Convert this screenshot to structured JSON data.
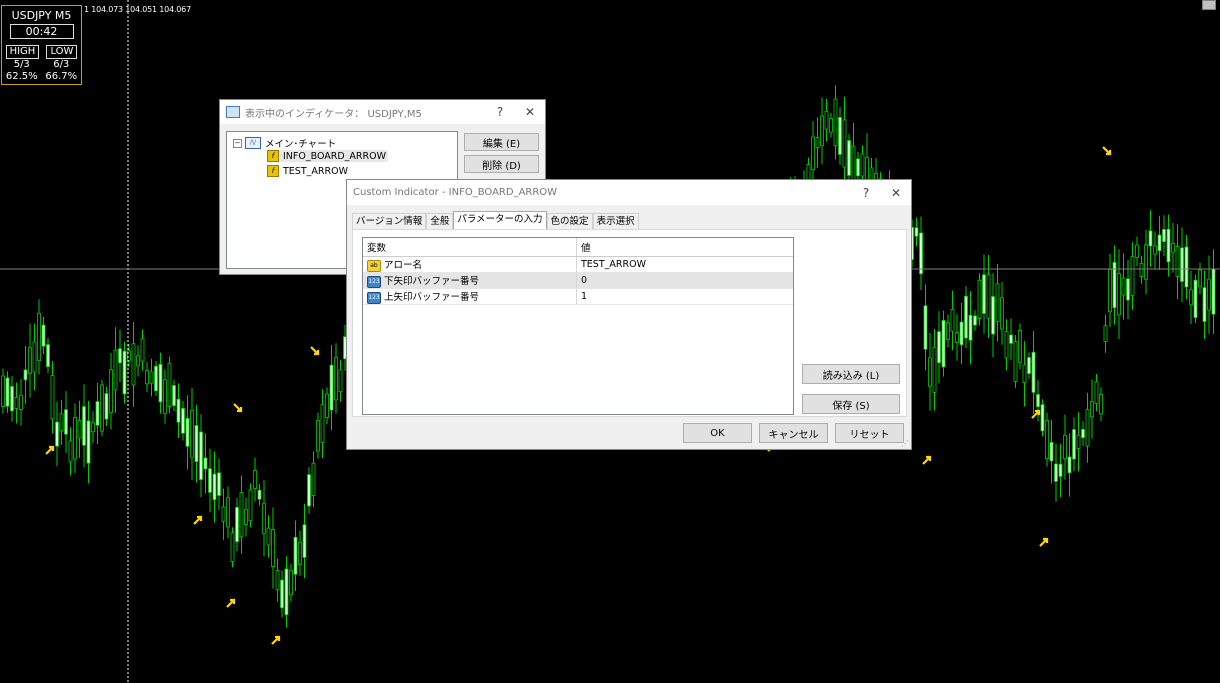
{
  "chart": {
    "ohlc_text": "1 104.073 104.051 104.067",
    "colors": {
      "background": "#000000",
      "candle": "#00cc00",
      "candle_bright": "#ccffcc",
      "arrow": "#ffd700",
      "crosshair": "#ffffff"
    }
  },
  "board": {
    "symbol": "USDJPY M5",
    "timer": "00:42",
    "high_label": "HIGH",
    "low_label": "LOW",
    "high_count": "5/3",
    "low_count": "6/3",
    "high_pct": "62.5%",
    "low_pct": "66.7%"
  },
  "indicators_window": {
    "title": "表示中のインディケータ： USDJPY,M5",
    "help": "?",
    "close": "✕",
    "tree": {
      "root": "メイン･チャート",
      "items": [
        "INFO_BOARD_ARROW",
        "TEST_ARROW"
      ]
    },
    "edit_button": "編集 (E)",
    "delete_button": "削除 (D)"
  },
  "custom_dialog": {
    "title": "Custom Indicator - INFO_BOARD_ARROW",
    "help": "?",
    "close": "✕",
    "tabs": [
      "バージョン情報",
      "全般",
      "パラメーターの入力",
      "色の設定",
      "表示選択"
    ],
    "active_tab": 2,
    "table": {
      "headers": [
        "変数",
        "値"
      ],
      "rows": [
        {
          "type": "ab",
          "name": "アロー名",
          "value": "TEST_ARROW"
        },
        {
          "type": "123",
          "name": "下矢印バッファー番号",
          "value": "0"
        },
        {
          "type": "123",
          "name": "上矢印バッファー番号",
          "value": "1"
        }
      ]
    },
    "load_button": "読み込み (L)",
    "save_button": "保存 (S)",
    "ok_button": "OK",
    "cancel_button": "キャンセル",
    "reset_button": "リセット",
    "grip": "⋰"
  }
}
